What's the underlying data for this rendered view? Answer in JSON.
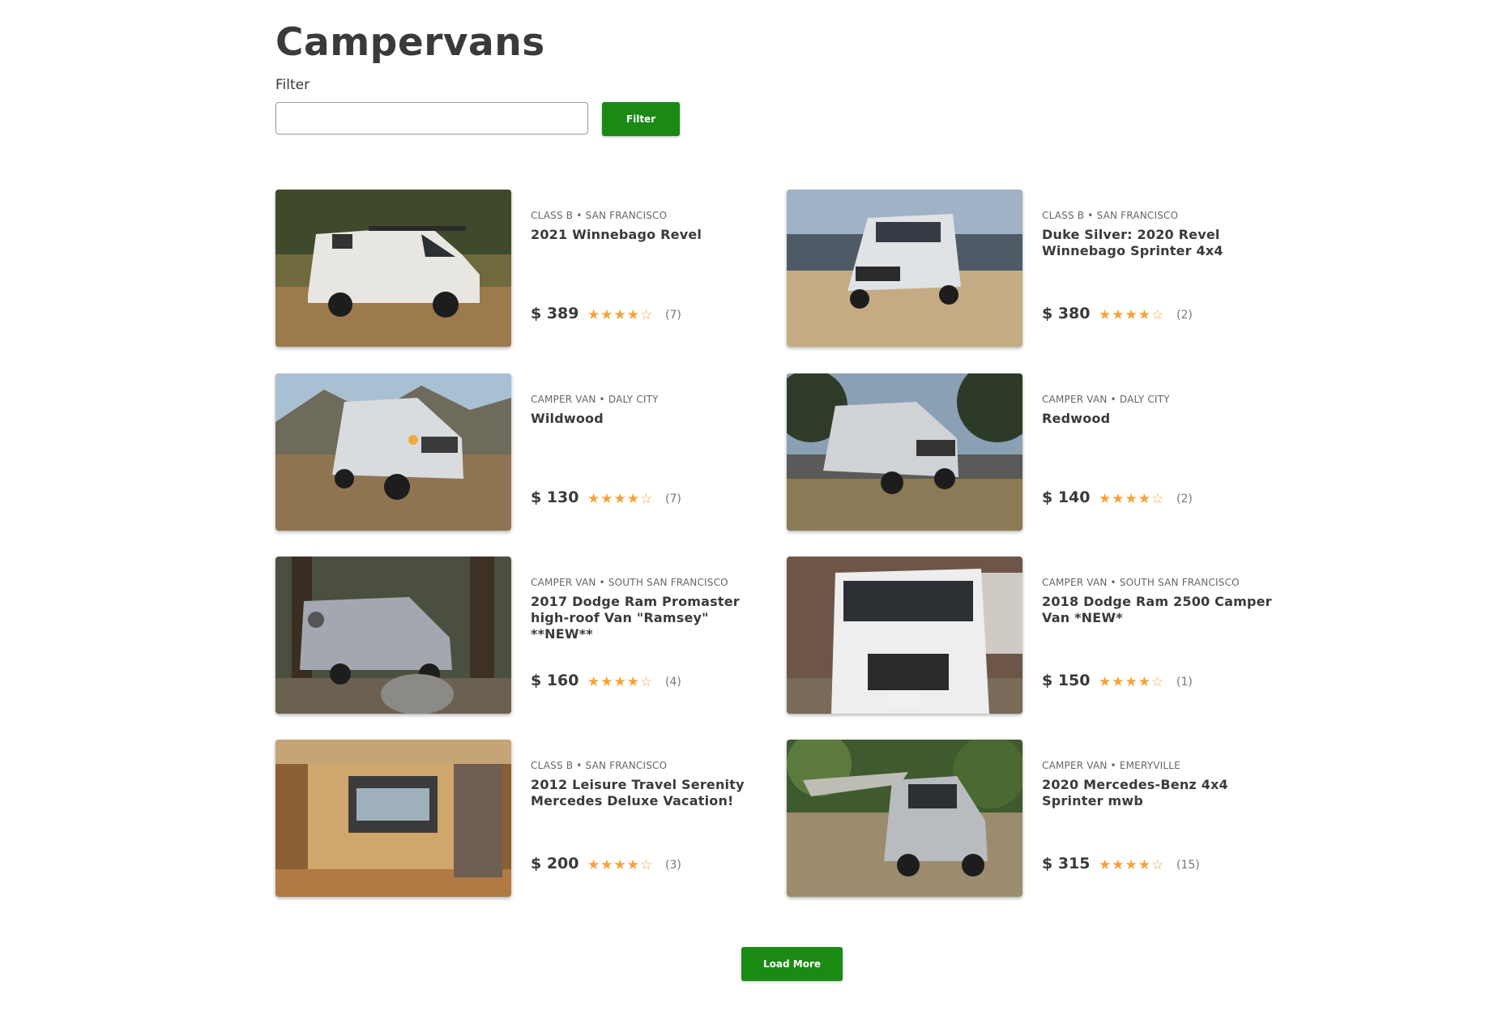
{
  "page": {
    "title": "Campervans"
  },
  "filter": {
    "label": "Filter",
    "value": "",
    "placeholder": "",
    "button_label": "Filter"
  },
  "listings": [
    {
      "meta": "CLASS B • SAN FRANCISCO",
      "name": "2021 Winnebago Revel",
      "price": "$ 389",
      "rating": 4,
      "stars": "★★★★☆",
      "reviews": "(7)"
    },
    {
      "meta": "CLASS B • SAN FRANCISCO",
      "name": "Duke Silver: 2020 Revel Winnebago Sprinter 4x4",
      "price": "$ 380",
      "rating": 4,
      "stars": "★★★★☆",
      "reviews": "(2)"
    },
    {
      "meta": "CAMPER VAN • DALY CITY",
      "name": "Wildwood",
      "price": "$ 130",
      "rating": 4,
      "stars": "★★★★☆",
      "reviews": "(7)"
    },
    {
      "meta": "CAMPER VAN • DALY CITY",
      "name": "Redwood",
      "price": "$ 140",
      "rating": 4,
      "stars": "★★★★☆",
      "reviews": "(2)"
    },
    {
      "meta": "CAMPER VAN • SOUTH SAN FRANCISCO",
      "name": "2017 Dodge Ram Promaster high-roof Van \"Ramsey\" **NEW**",
      "price": "$ 160",
      "rating": 4,
      "stars": "★★★★☆",
      "reviews": "(4)"
    },
    {
      "meta": "CAMPER VAN • SOUTH SAN FRANCISCO",
      "name": "2018 Dodge Ram 2500 Camper Van *NEW*",
      "price": "$ 150",
      "rating": 4,
      "stars": "★★★★☆",
      "reviews": "(1)"
    },
    {
      "meta": "CLASS B • SAN FRANCISCO",
      "name": "2012 Leisure Travel Serenity Mercedes Deluxe Vacation!",
      "price": "$ 200",
      "rating": 4,
      "stars": "★★★★☆",
      "reviews": "(3)"
    },
    {
      "meta": "CAMPER VAN • EMERYVILLE",
      "name": "2020 Mercedes-Benz 4x4 Sprinter mwb",
      "price": "$ 315",
      "rating": 4,
      "stars": "★★★★☆",
      "reviews": "(15)"
    }
  ],
  "load_more": {
    "label": "Load More"
  },
  "colors": {
    "accent": "#1b8a14",
    "star": "#f5a23b",
    "text": "#3a3a3a",
    "muted": "#666666"
  },
  "icons": {
    "star": "star-icon",
    "star_empty": "star-outline-icon"
  }
}
